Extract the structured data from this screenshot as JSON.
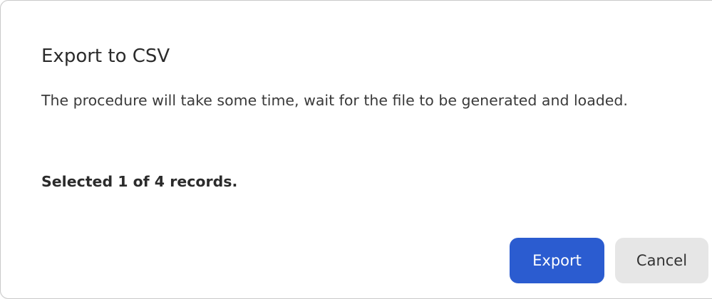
{
  "dialog": {
    "title": "Export to CSV",
    "message": "The procedure will take some time, wait for the file to be generated and loaded.",
    "selection_info": "Selected 1 of 4 records.",
    "export_label": "Export",
    "cancel_label": "Cancel"
  },
  "colors": {
    "primary": "#2b5cd0",
    "secondary": "#e6e6e6",
    "border": "#c9c9c9"
  }
}
